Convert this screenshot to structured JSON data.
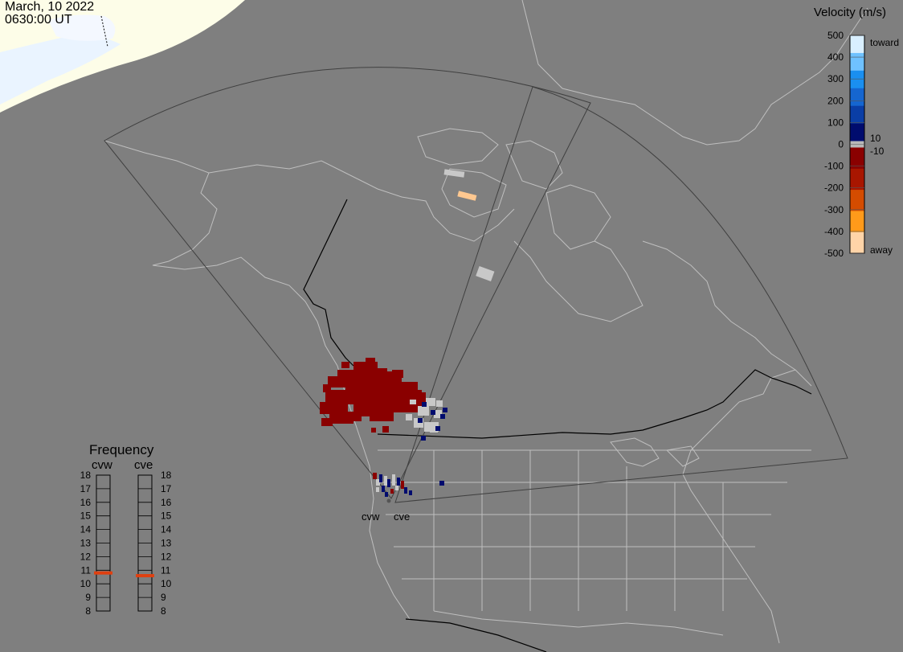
{
  "timestamp": {
    "date": "March, 10 2022",
    "time": "0630:00 UT"
  },
  "radars": [
    {
      "code": "cvw"
    },
    {
      "code": "cve"
    }
  ],
  "velocity_colorbar": {
    "title": "Velocity (m/s)",
    "tick_labels": [
      "500",
      "400",
      "300",
      "200",
      "100",
      "0",
      "-100",
      "-200",
      "-300",
      "-400",
      "-500"
    ],
    "inner_labels": [
      "10",
      "-10"
    ],
    "toward_label": "toward",
    "away_label": "away",
    "colors_top_to_bottom": [
      "#d9efff",
      "#6fc1ff",
      "#1a8ff0",
      "#1566d0",
      "#0a3ea6",
      "#000c6e",
      "#b8b8b8",
      "#8a0000",
      "#a81600",
      "#d44c00",
      "#ff9a1a",
      "#ffd4a8"
    ]
  },
  "frequency_panel": {
    "title": "Frequency",
    "columns": [
      {
        "radar": "cvw",
        "frequency_mhz": 10.8
      },
      {
        "radar": "cve",
        "frequency_mhz": 10.6
      }
    ],
    "scale_labels": [
      "18",
      "17",
      "16",
      "15",
      "14",
      "13",
      "12",
      "11",
      "10",
      "9",
      "8"
    ],
    "marker_color": "#e04010"
  },
  "colors": {
    "background": "#7f7f7f",
    "coastline": "#bfbfbf",
    "border": "#000000",
    "field_of_view": "#404040",
    "daylight_region": "#fdfde8",
    "ice": "#eaf4ff"
  }
}
